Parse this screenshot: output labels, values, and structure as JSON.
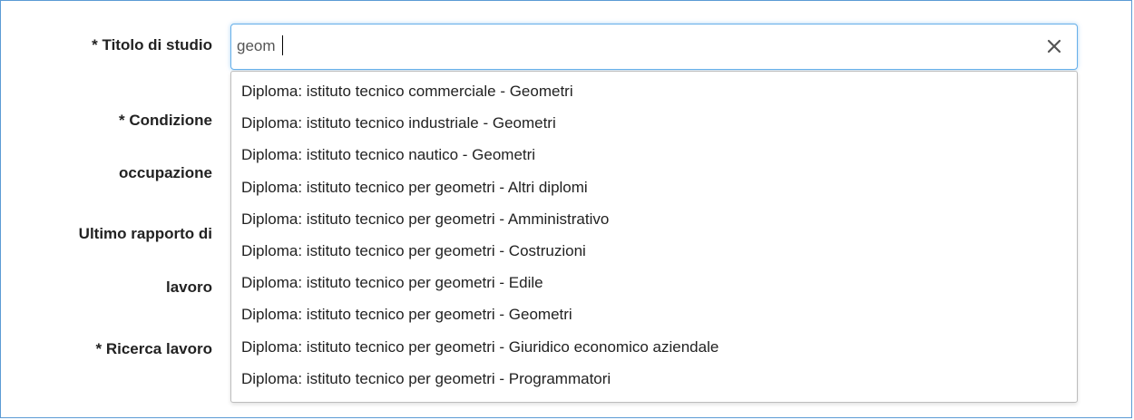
{
  "form": {
    "labels": {
      "titolo": "* Titolo di studio",
      "condizione": "* Condizione",
      "occupazione": "occupazione",
      "ultimo": "Ultimo rapporto di",
      "lavoro": "lavoro",
      "ricerca": "* Ricerca lavoro"
    },
    "titolo_input": {
      "value": "geom"
    },
    "clear_icon": "close-icon"
  },
  "dropdown": {
    "options": [
      "Diploma: istituto tecnico commerciale - Geometri",
      "Diploma: istituto tecnico industriale - Geometri",
      "Diploma: istituto tecnico nautico - Geometri",
      "Diploma: istituto tecnico per geometri - Altri diplomi",
      "Diploma: istituto tecnico per geometri - Amministrativo",
      "Diploma: istituto tecnico per geometri - Costruzioni",
      "Diploma: istituto tecnico per geometri - Edile",
      "Diploma: istituto tecnico per geometri - Geometri",
      "Diploma: istituto tecnico per geometri - Giuridico economico aziendale",
      "Diploma: istituto tecnico per geometri - Programmatori"
    ]
  }
}
